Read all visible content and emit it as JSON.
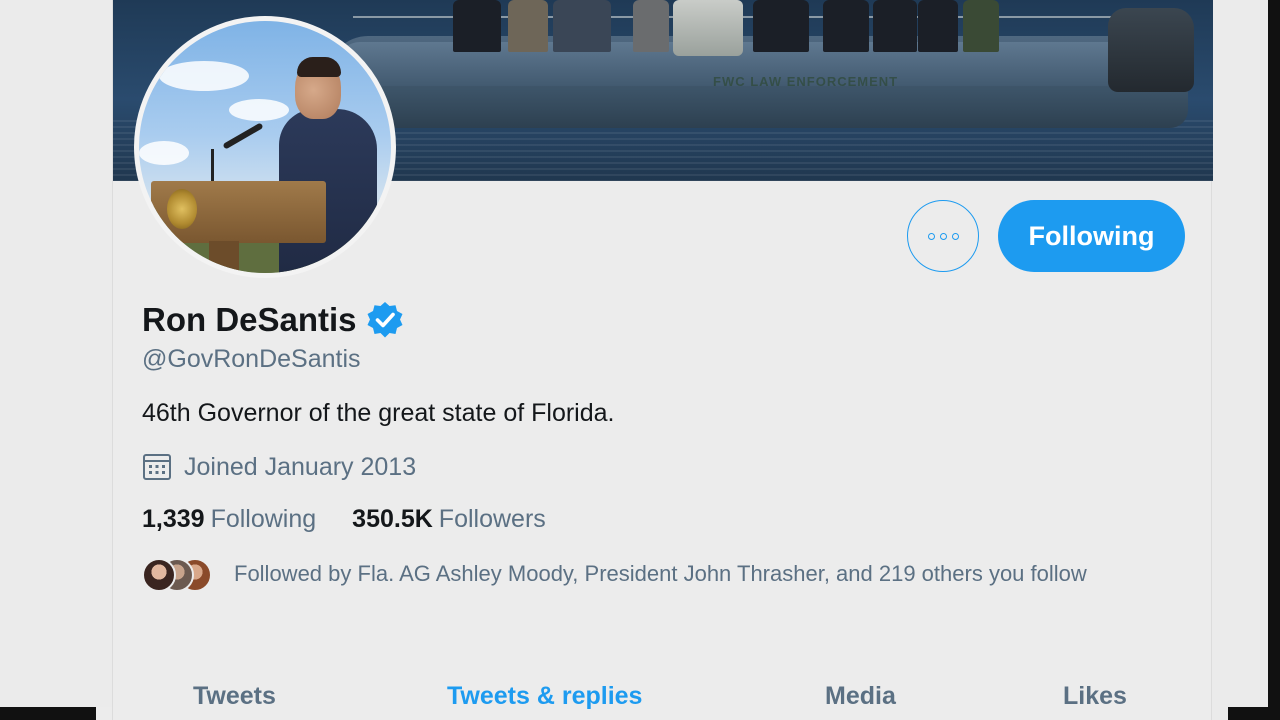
{
  "profile": {
    "display_name": "Ron DeSantis",
    "verified_icon": "verified-badge-icon",
    "handle": "@GovRonDeSantis",
    "bio": "46th Governor of the great state of Florida.",
    "joined": "Joined January 2013",
    "stats": {
      "following_count": "1,339",
      "following_label": "Following",
      "followers_count": "350.5K",
      "followers_label": "Followers"
    },
    "followed_by": "Followed by Fla. AG Ashley Moody, President John Thrasher, and 219 others you follow"
  },
  "actions": {
    "more_icon": "more-options-icon",
    "following_label": "Following"
  },
  "tabs": [
    {
      "label": "Tweets",
      "active": false
    },
    {
      "label": "Tweets & replies",
      "active": true
    },
    {
      "label": "Media",
      "active": false
    },
    {
      "label": "Likes",
      "active": false
    }
  ],
  "banner": {
    "boat_text": "FWC LAW ENFORCEMENT"
  },
  "colors": {
    "accent": "#1d9bf0",
    "text_primary": "#14171a",
    "text_secondary": "#5b7083",
    "background": "#ececec"
  }
}
